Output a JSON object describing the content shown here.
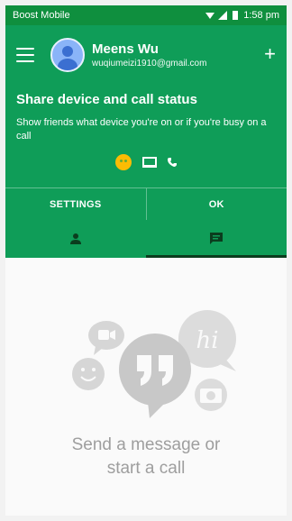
{
  "status_bar": {
    "carrier": "Boost Mobile",
    "time": "1:58 pm"
  },
  "account": {
    "name": "Meens Wu",
    "email": "wuqiumeizi1910@gmail.com"
  },
  "share_card": {
    "title": "Share device and call status",
    "description": "Show friends what device you're on or if you're busy on a call",
    "settings_label": "SETTINGS",
    "ok_label": "OK"
  },
  "tabs": [
    {
      "icon": "person-icon",
      "selected": false
    },
    {
      "icon": "chat-icon",
      "selected": true
    }
  ],
  "empty_state": {
    "line1": "Send a message or",
    "line2": "start a call",
    "bubble_text": "hi"
  },
  "colors": {
    "primary": "#0f9d58",
    "status_bar": "#0f8f3e",
    "indicator": "#0b3d1e",
    "empty_text": "#9e9e9e"
  }
}
